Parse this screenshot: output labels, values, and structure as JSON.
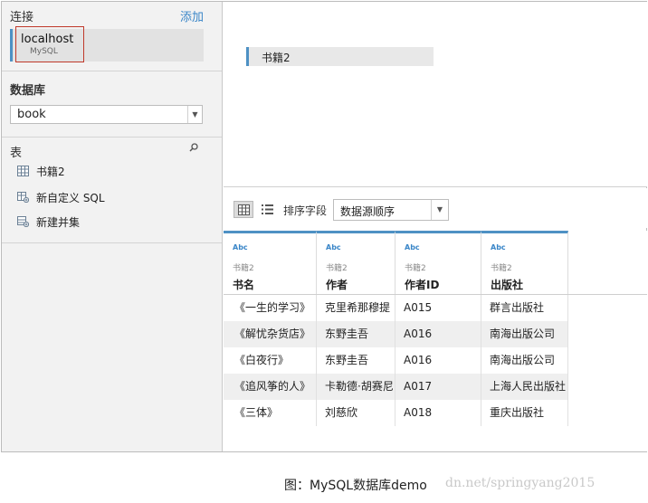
{
  "connections": {
    "title": "连接",
    "add_label": "添加",
    "item": {
      "name": "localhost",
      "type": "MySQL"
    }
  },
  "database": {
    "title": "数据库",
    "selected": "book"
  },
  "tables": {
    "title": "表",
    "items": [
      {
        "label": "书籍2",
        "icon": "table-icon"
      },
      {
        "label": "新自定义 SQL",
        "icon": "custom-sql-icon"
      },
      {
        "label": "新建并集",
        "icon": "union-icon"
      }
    ]
  },
  "canvas": {
    "table_label": "书籍2"
  },
  "toolbar": {
    "sort_label": "排序字段",
    "sort_value": "数据源顺序"
  },
  "grid": {
    "columns": [
      {
        "type": "Abc",
        "source": "书籍2",
        "name": "书名"
      },
      {
        "type": "Abc",
        "source": "书籍2",
        "name": "作者"
      },
      {
        "type": "Abc",
        "source": "书籍2",
        "name": "作者ID"
      },
      {
        "type": "Abc",
        "source": "书籍2",
        "name": "出版社"
      }
    ],
    "rows": [
      [
        "《一生的学习》",
        "克里希那穆提",
        "A015",
        "群言出版社"
      ],
      [
        "《解忧杂货店》",
        "东野圭吾",
        "A016",
        "南海出版公司"
      ],
      [
        "《白夜行》",
        "东野圭吾",
        "A016",
        "南海出版公司"
      ],
      [
        "《追风筝的人》",
        "卡勒德·胡赛尼",
        "A017",
        "上海人民出版社"
      ],
      [
        "《三体》",
        "刘慈欣",
        "A018",
        "重庆出版社"
      ]
    ]
  },
  "caption": "图：MySQL数据库demo",
  "watermark": "dn.net/springyang2015",
  "colors": {
    "accent": "#4e91c4",
    "link": "#3a86c8",
    "highlight": "#c0392b"
  }
}
